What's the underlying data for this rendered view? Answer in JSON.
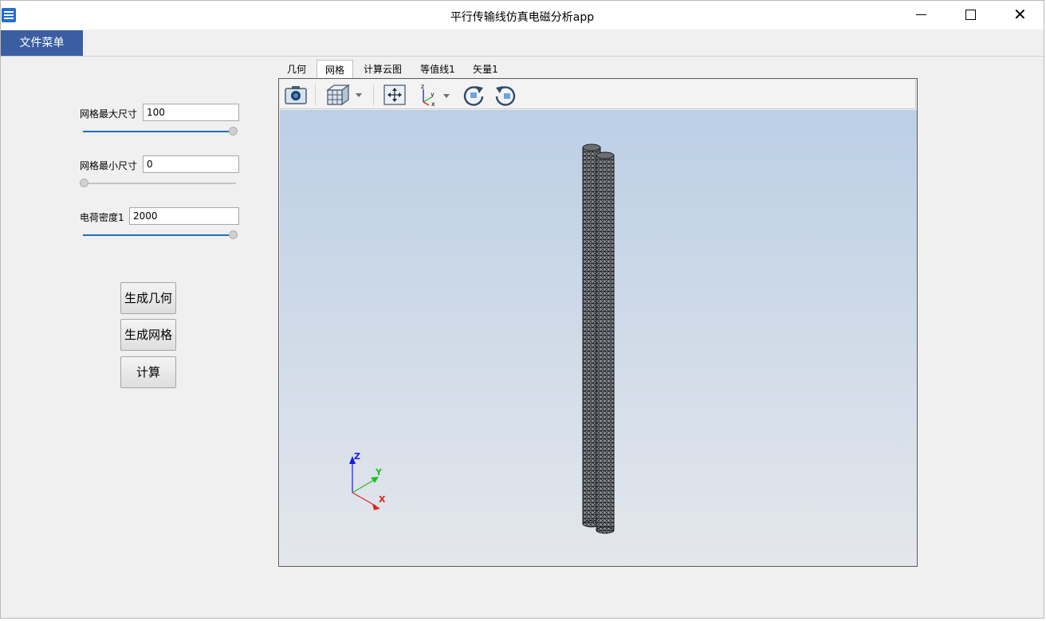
{
  "window": {
    "title": "平行传输线仿真电磁分析app",
    "minimize_icon": "minimize-icon",
    "maximize_icon": "maximize-icon",
    "close_icon": "close-icon",
    "close_glyph": "✕"
  },
  "menu": {
    "file_label": "文件菜单"
  },
  "params": {
    "max_size": {
      "label": "网格最大尺寸",
      "value": "100",
      "slider_level": 1.0
    },
    "min_size": {
      "label": "网格最小尺寸",
      "value": "0",
      "slider_level": 0.0
    },
    "charge_density": {
      "label": "电荷密度1",
      "value": "2000",
      "slider_level": 1.0
    }
  },
  "buttons": {
    "gen_geometry": "生成几何",
    "gen_mesh": "生成网格",
    "compute": "计算"
  },
  "tabs": [
    {
      "label": "几何",
      "active": false
    },
    {
      "label": "网格",
      "active": true
    },
    {
      "label": "计算云图",
      "active": false
    },
    {
      "label": "等值线1",
      "active": false
    },
    {
      "label": "矢量1",
      "active": false
    }
  ],
  "toolbar": {
    "icons": [
      "camera-icon",
      "cube-view-icon",
      "fit-view-icon",
      "axes-orient-icon",
      "rotate-cw-icon",
      "rotate-ccw-icon"
    ]
  },
  "triad": {
    "z": "Z",
    "y": "Y",
    "x": "X"
  },
  "colors": {
    "accent": "#3b5ea2",
    "slider_fill": "#1f6fba",
    "canvas_top": "#bccfe5",
    "canvas_bottom": "#e4e7ec",
    "axis_x": "#e8201a",
    "axis_y": "#1fbf1f",
    "axis_z": "#1a1ae8"
  }
}
